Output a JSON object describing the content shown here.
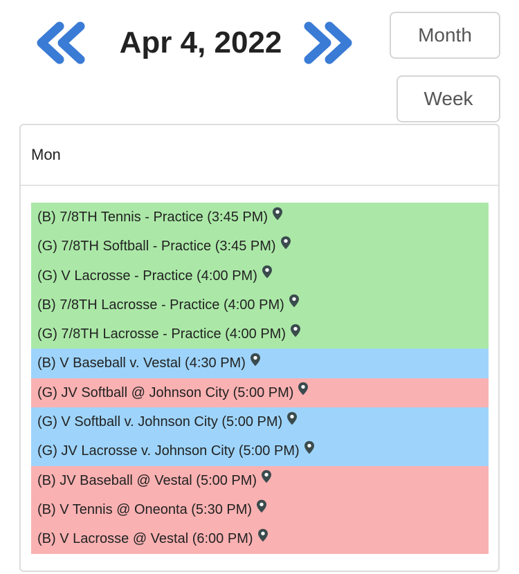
{
  "header": {
    "date_title": "Apr 4, 2022",
    "prev_icon": "double-chevron-left-icon",
    "next_icon": "double-chevron-right-icon",
    "accent_color": "#3a7bd5"
  },
  "view_buttons": {
    "month_label": "Month",
    "week_label": "Week"
  },
  "day": {
    "label": "Mon",
    "colors": {
      "practice": "#abe8a7",
      "home": "#9ed4fb",
      "away": "#fab1b2"
    },
    "events": [
      {
        "text": "(B) 7/8TH Tennis - Practice (3:45 PM)",
        "type": "practice",
        "icon": "location-pin-icon"
      },
      {
        "text": "(G) 7/8TH Softball - Practice (3:45 PM)",
        "type": "practice",
        "icon": "location-pin-icon"
      },
      {
        "text": "(G) V Lacrosse - Practice (4:00 PM)",
        "type": "practice",
        "icon": "location-pin-icon"
      },
      {
        "text": "(B) 7/8TH Lacrosse - Practice (4:00 PM)",
        "type": "practice",
        "icon": "location-pin-icon"
      },
      {
        "text": "(G) 7/8TH Lacrosse - Practice (4:00 PM)",
        "type": "practice",
        "icon": "location-pin-icon"
      },
      {
        "text": "(B) V Baseball v. Vestal (4:30 PM)",
        "type": "home",
        "icon": "location-pin-icon"
      },
      {
        "text": "(G) JV Softball @ Johnson City (5:00 PM)",
        "type": "away",
        "icon": "location-pin-icon"
      },
      {
        "text": "(G) V Softball v. Johnson City (5:00 PM)",
        "type": "home",
        "icon": "location-pin-icon"
      },
      {
        "text": "(G) JV Lacrosse v. Johnson City (5:00 PM)",
        "type": "home",
        "icon": "location-pin-icon"
      },
      {
        "text": "(B) JV Baseball @ Vestal (5:00 PM)",
        "type": "away",
        "icon": "location-pin-icon"
      },
      {
        "text": "(B) V Tennis @ Oneonta (5:30 PM)",
        "type": "away",
        "icon": "location-pin-icon"
      },
      {
        "text": "(B) V Lacrosse @ Vestal (6:00 PM)",
        "type": "away",
        "icon": "location-pin-icon"
      }
    ]
  }
}
